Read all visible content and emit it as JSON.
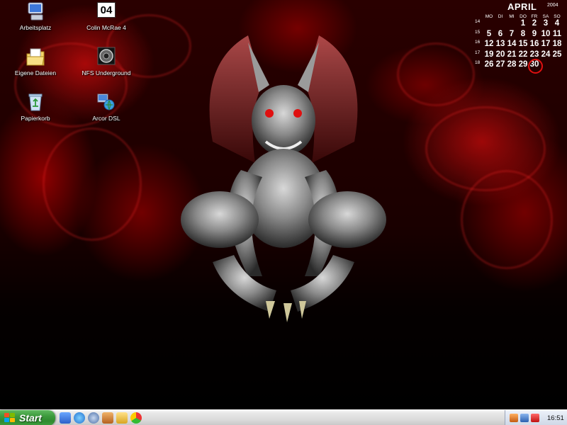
{
  "desktop_icons": [
    {
      "label": "Arbeitsplatz",
      "icon": "computer-icon"
    },
    {
      "label": "Colin McRae 4",
      "icon": "colin-mcrae-icon",
      "badge": "04"
    },
    {
      "label": "Eigene Dateien",
      "icon": "my-documents-icon"
    },
    {
      "label": "NFS Underground",
      "icon": "nfs-underground-icon"
    },
    {
      "label": "Papierkorb",
      "icon": "recycle-bin-icon"
    },
    {
      "label": "Arcor DSL",
      "icon": "network-connection-icon"
    }
  ],
  "calendar": {
    "month": "APRIL",
    "year": "2004",
    "weekdays": [
      "MO",
      "DI",
      "MI",
      "DO",
      "FR",
      "SA",
      "SO"
    ],
    "weeks": [
      {
        "week": "14",
        "days": [
          "",
          "",
          "",
          "1",
          "2",
          "3",
          "4"
        ]
      },
      {
        "week": "15",
        "days": [
          "5",
          "6",
          "7",
          "8",
          "9",
          "10",
          "11"
        ]
      },
      {
        "week": "16",
        "days": [
          "12",
          "13",
          "14",
          "15",
          "16",
          "17",
          "18"
        ]
      },
      {
        "week": "17",
        "days": [
          "19",
          "20",
          "21",
          "22",
          "23",
          "24",
          "25"
        ]
      },
      {
        "week": "18",
        "days": [
          "26",
          "27",
          "28",
          "29",
          "30",
          "",
          ""
        ]
      }
    ],
    "today": "30",
    "highlight_color": "#e01010"
  },
  "taskbar": {
    "start_label": "Start",
    "quicklaunch": [
      "show-desktop-icon",
      "internet-explorer-icon",
      "browser-icon",
      "media-icon",
      "folder-icon",
      "chrome-like-icon"
    ],
    "tray_icons": [
      "tray-app-icon",
      "tray-network-icon",
      "tray-antivirus-icon"
    ],
    "clock": "16:51"
  },
  "colors": {
    "accent": "#c00000",
    "start_green": "#3c9a3c"
  }
}
